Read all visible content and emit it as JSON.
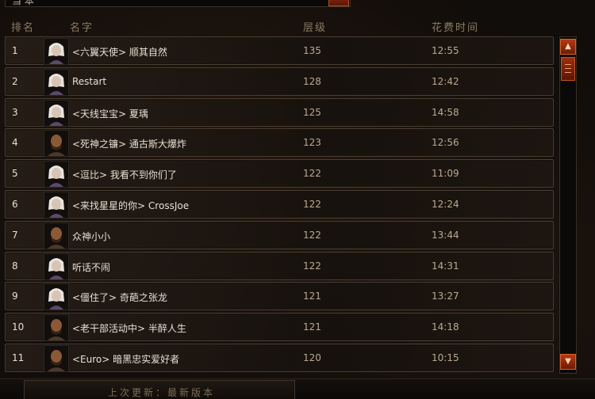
{
  "top_field": {
    "value": "当 本"
  },
  "header": {
    "rank": "排名",
    "name": "名字",
    "level": "层级",
    "time": "花费时间"
  },
  "rows": [
    {
      "rank": "1",
      "name": "<六翼天使> 顺其自然",
      "level": "135",
      "time": "12:55",
      "avatar": "female"
    },
    {
      "rank": "2",
      "name": "Restart",
      "level": "128",
      "time": "12:42",
      "avatar": "female"
    },
    {
      "rank": "3",
      "name": "<天线宝宝> 夏瑀",
      "level": "125",
      "time": "14:58",
      "avatar": "female"
    },
    {
      "rank": "4",
      "name": "<死神之镰> 通古斯大爆炸",
      "level": "123",
      "time": "12:56",
      "avatar": "male"
    },
    {
      "rank": "5",
      "name": "<逗比> 我看不到你们了",
      "level": "122",
      "time": "11:09",
      "avatar": "female"
    },
    {
      "rank": "6",
      "name": "<来找星星的你> CrossJoe",
      "level": "122",
      "time": "12:24",
      "avatar": "female"
    },
    {
      "rank": "7",
      "name": "众神小小",
      "level": "122",
      "time": "13:44",
      "avatar": "male"
    },
    {
      "rank": "8",
      "name": "听话不闹",
      "level": "122",
      "time": "14:31",
      "avatar": "female"
    },
    {
      "rank": "9",
      "name": "<僵住了> 奇葩之张龙",
      "level": "121",
      "time": "13:27",
      "avatar": "female"
    },
    {
      "rank": "10",
      "name": "<老干部活动中> 半醉人生",
      "level": "121",
      "time": "14:18",
      "avatar": "male"
    },
    {
      "rank": "11",
      "name": "<Euro> 暗黑忠实爱好者",
      "level": "120",
      "time": "10:15",
      "avatar": "male"
    }
  ],
  "footer": {
    "text": "上次更新：最新版本"
  },
  "icons": {
    "scroll_up": "triangle-up-icon",
    "scroll_down": "triangle-down-icon",
    "avatar_female": "female-portrait-icon",
    "avatar_male": "male-portrait-icon"
  },
  "colors": {
    "accent": "#b63a12",
    "row_border": "#4a3e33",
    "text": "#e7e0d4"
  }
}
